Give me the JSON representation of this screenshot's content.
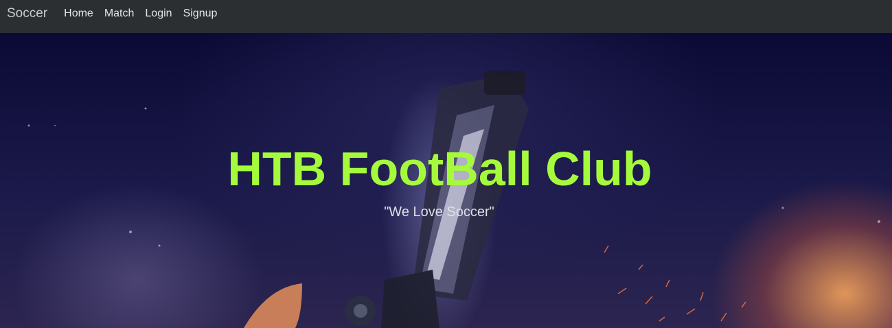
{
  "navbar": {
    "brand": "Soccer",
    "links": [
      {
        "label": "Home"
      },
      {
        "label": "Match"
      },
      {
        "label": "Login"
      },
      {
        "label": "Signup"
      }
    ]
  },
  "hero": {
    "title": "HTB FootBall Club",
    "subtitle": "\"We Love Soccer\"",
    "title_color": "#a6fa3c",
    "background_image": "soccer-boot-with-sparks"
  }
}
